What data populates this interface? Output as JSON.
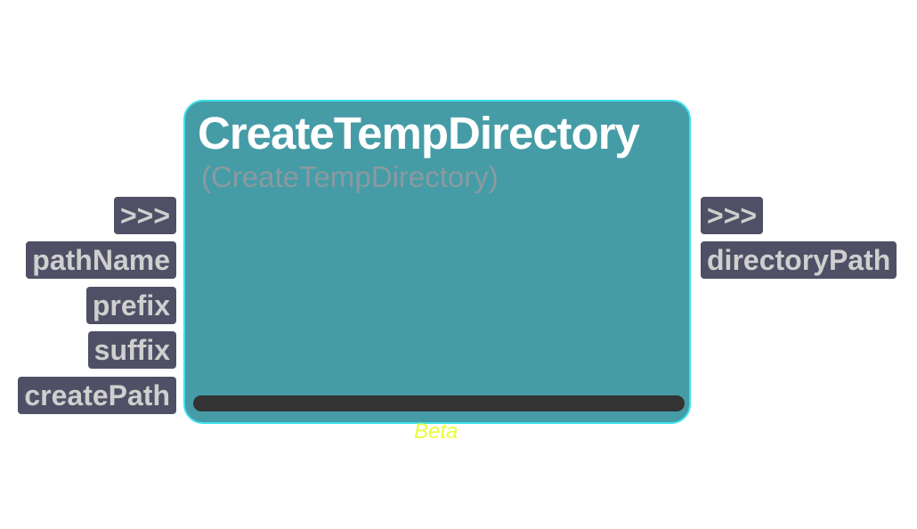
{
  "node": {
    "title": "CreateTempDirectory",
    "subtitle": "(CreateTempDirectory)",
    "status": "Beta",
    "progress": 0
  },
  "inputs": [
    {
      "label": ">>>"
    },
    {
      "label": "pathName"
    },
    {
      "label": "prefix"
    },
    {
      "label": "suffix"
    },
    {
      "label": "createPath"
    }
  ],
  "outputs": [
    {
      "label": ">>>"
    },
    {
      "label": "directoryPath"
    }
  ],
  "colors": {
    "node_fill": "#459ca6",
    "node_border": "#3fe0ea",
    "pin_fill": "#4f4f66",
    "pin_text": "#cfcfcf",
    "status_text": "#e8ff3a",
    "progress_track": "#333333"
  }
}
